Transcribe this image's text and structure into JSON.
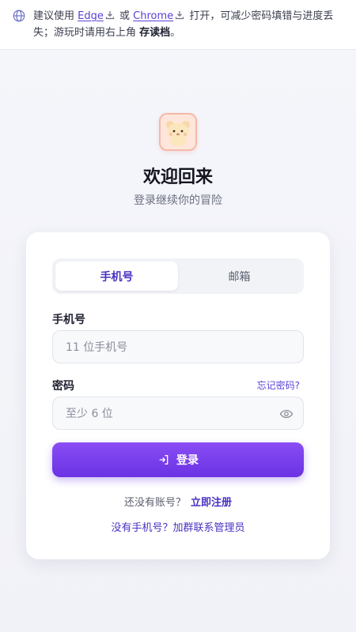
{
  "banner": {
    "text_prefix": "建议使用",
    "edge_label": "Edge",
    "or_text": "或",
    "chrome_label": "Chrome",
    "text_middle": "打开，可减少密码填错与进度丢失；游玩时请用右上角",
    "save_label": "存读档",
    "text_end": "。"
  },
  "header": {
    "title": "欢迎回来",
    "subtitle": "登录继续你的冒险"
  },
  "tabs": [
    {
      "label": "手机号",
      "active": true
    },
    {
      "label": "邮箱",
      "active": false
    }
  ],
  "form": {
    "phone_label": "手机号",
    "phone_placeholder": "11 位手机号",
    "password_label": "密码",
    "forgot_label": "忘记密码?",
    "password_placeholder": "至少 6 位",
    "login_label": "登录"
  },
  "footer": {
    "no_account_text": "还没有账号？",
    "register_label": "立即注册",
    "admin_label": "没有手机号？加群联系管理员"
  },
  "colors": {
    "accent": "#6a32e3",
    "link": "#4a32c2"
  }
}
